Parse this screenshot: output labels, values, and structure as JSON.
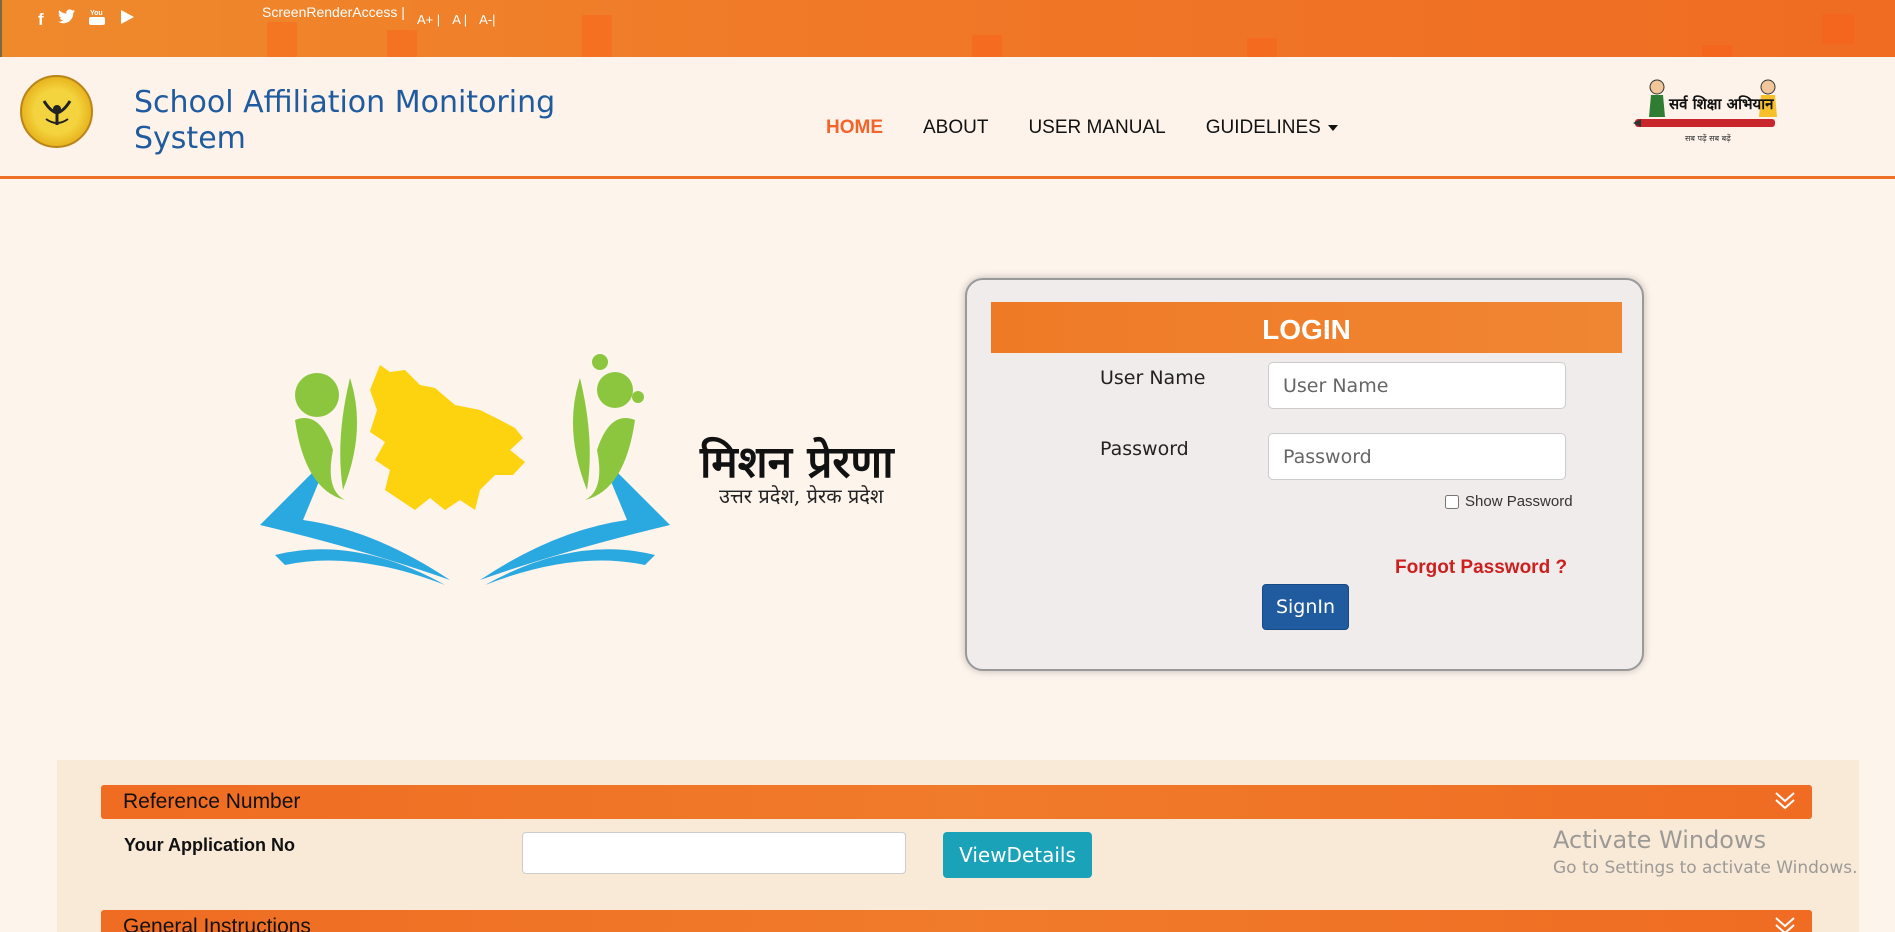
{
  "topbar": {
    "social": [
      {
        "icon": "facebook-icon",
        "glyph": "f"
      },
      {
        "icon": "twitter-icon",
        "glyph": "🐦"
      },
      {
        "icon": "youtube-icon",
        "glyph": "▣"
      },
      {
        "icon": "play-icon",
        "glyph": "▶"
      }
    ],
    "access_label": "ScreenRenderAccess |",
    "font_increase": "A+ |",
    "font_normal": "A |",
    "font_decrease": "A-|"
  },
  "header": {
    "title": "School Affiliation Monitoring System",
    "nav": [
      "HOME",
      "ABOUT",
      "USER MANUAL",
      "GUIDELINES"
    ],
    "ssa_logo_text": "सर्व शिक्षा अभियान",
    "ssa_tagline": "सब पढ़ें सब बढ़ें"
  },
  "mission": {
    "title": "मिशन प्रेरणा",
    "subtitle": "उत्तर प्रदेश, प्रेरक प्रदेश"
  },
  "login": {
    "heading": "LOGIN",
    "username_label": "User Name",
    "username_placeholder": "User Name",
    "password_label": "Password",
    "password_placeholder": "Password",
    "show_password": "Show Password",
    "forgot": "Forgot Password ?",
    "signin": "SignIn"
  },
  "reference": {
    "heading": "Reference Number",
    "app_no_label": "Your Application No",
    "view_button": "ViewDetails"
  },
  "instructions": {
    "heading": "General Instructions"
  },
  "watermark": {
    "line1": "Activate Windows",
    "line2": "Go to Settings to activate Windows."
  },
  "colors": {
    "orange": "#ef6c22",
    "blue": "#1f5b9e",
    "teal": "#1aa3b8",
    "red": "#cc1f1f"
  }
}
